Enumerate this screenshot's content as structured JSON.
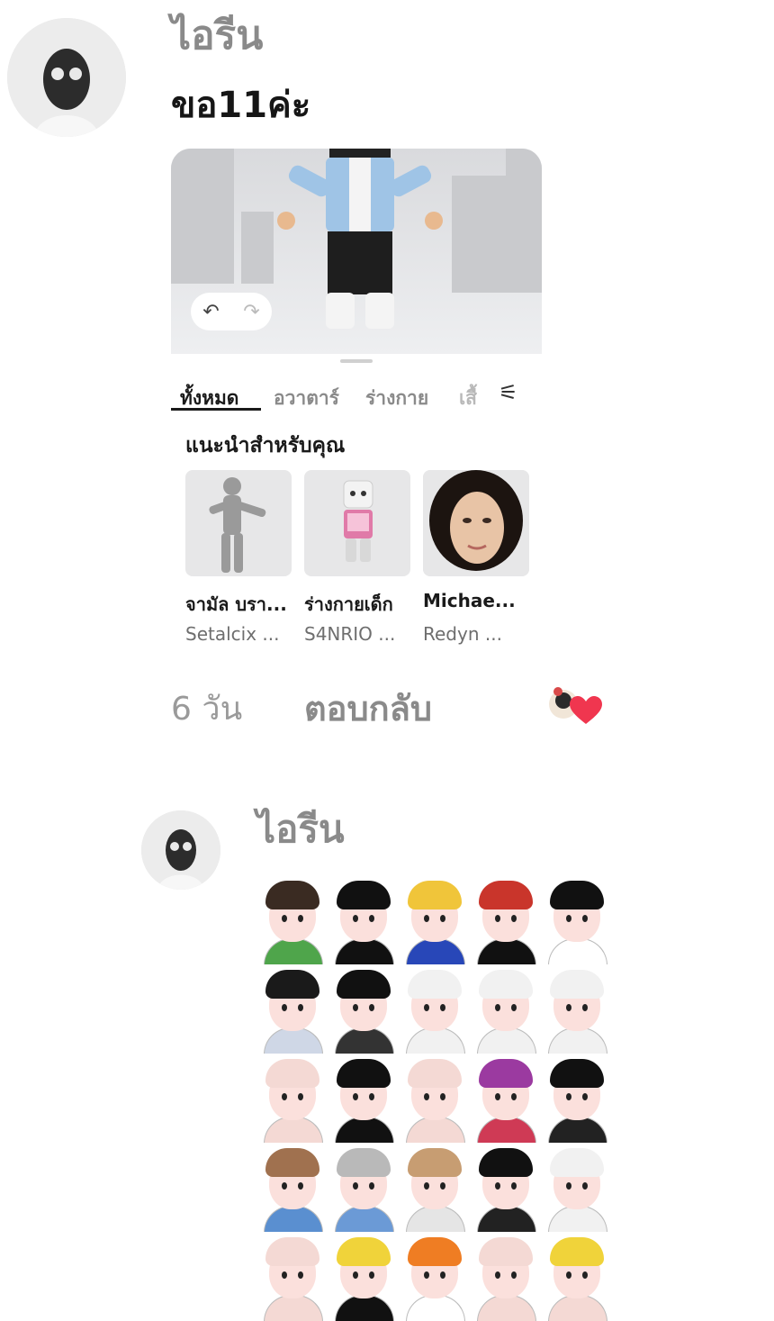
{
  "comment1": {
    "username": "ไอรีน",
    "text": "ขอ11ค่ะ",
    "time": "6 วัน",
    "reply_label": "ตอบกลับ"
  },
  "card": {
    "tabs": [
      "ทั้งหมด",
      "อวาตาร์",
      "ร่างกาย",
      "เสื้"
    ],
    "section_title": "แนะนำสำหรับคุณ",
    "items": [
      {
        "name": "จามัล บรา...",
        "creator": "Setalcix ..."
      },
      {
        "name": "ร่างกายเด็ก",
        "creator": "S4NRIO ..."
      },
      {
        "name": "Michae...",
        "creator": "Redyn ..."
      }
    ]
  },
  "comment2": {
    "username": "ไอรีน"
  },
  "icons": {
    "undo": "undo-icon",
    "redo": "redo-icon",
    "filter": "filter-icon",
    "like": "heart-icon"
  },
  "colors": {
    "like_heart": "#f0364f"
  }
}
